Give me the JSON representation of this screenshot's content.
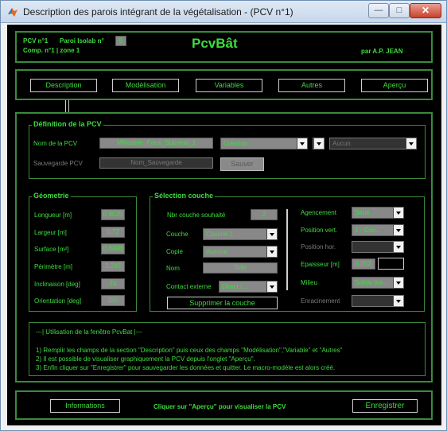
{
  "window": {
    "title": "Description des parois intégrant de la végétalisation - (PCV n°1)",
    "min_glyph": "—",
    "max_glyph": "□",
    "close_glyph": "✕"
  },
  "header": {
    "pcv_label": "PCV n°1",
    "paroi_label": "Paroi Isolab n°",
    "paroi_value": "5",
    "comp_label": "Comp. n°1 | zone 1",
    "app_name": "PcvBât",
    "author": "par A.P. JEAN"
  },
  "tabs": {
    "description": "Description",
    "modelisation": "Modélisation",
    "variables": "Variables",
    "autres": "Autres",
    "apercu": "Aperçu"
  },
  "definition": {
    "title": "Définition de la PCV",
    "nom_label": "Nom de la  PCV",
    "nom_value": "MModele_Paroi_Substrat_1",
    "mode_value": "Création",
    "aucun_value": "Aucun",
    "sauvegarde_label": "Sauvegarde PCV",
    "sauvegarde_value": "Nom_Sauvegarde",
    "sauver_label": "Sauver"
  },
  "geometrie": {
    "title": "Géometrie",
    "rows": [
      {
        "label": "Longueur [m]",
        "value": "0.9025"
      },
      {
        "label": "Largeur [m]",
        "value": "0.72"
      },
      {
        "label": "Surface [m²]",
        "value": "0.6498"
      },
      {
        "label": "Périmètre  [m]",
        "value": "3.245"
      },
      {
        "label": "Inclinaison [deg]",
        "value": "24"
      },
      {
        "label": "Orientation [deg]",
        "value": "180"
      }
    ]
  },
  "selection": {
    "title": "Sélection couche",
    "nb_label": "Nbr couche souhaité",
    "nb_value": "2",
    "couche_label": "Couche",
    "couche_value": "Couche 1",
    "copie_label": "Copie",
    "copie_value": "Aucune",
    "nom_label": "Nom",
    "nom_value": "Toile",
    "contact_label": "Contact externe",
    "contact_value": "Direct     (...",
    "supprimer_label": "Supprimer la couche",
    "agencement_label": "Agencement",
    "agencement_value": "Série",
    "posvert_label": "Position vert.",
    "posvert_value": "1  -  Cou...",
    "poshor_label": "Position hor.",
    "poshor_value": "",
    "epaisseur_label": "Epaisseur [m]",
    "epaisseur_value": "0.002",
    "epaisseur_extra": "",
    "milieu_label": "Milieu",
    "milieu_value": "Solide ine...",
    "enracinement_label": "Enracinement",
    "enracinement_value": ""
  },
  "info": {
    "header": "---| Utilisation de la fenêtre PcvBat |---",
    "line1": "1) Remplir les champs de la section \"Description\" puis ceux des champs \"Modélisation\",\"Variable\" et \"Autres\"",
    "line2": "2) Il est possible de visualiser graphiquement la PCV depuis l'onglet \"Aperçu\".",
    "line3": "3) Enfin cliquer sur \"Enregistrer\" pour sauvegarder les données et quitter. Le macro-modèle est alors créé."
  },
  "footer": {
    "informations": "Informations",
    "hint": "Cliquer sur \"Aperçu\" pour visualiser la PCV",
    "enregistrer": "Enregistrer"
  },
  "colors": {
    "accent_green": "#3fdc3f",
    "panel_border": "#3a8a3a",
    "background": "#000000"
  },
  "icons": {
    "app": "matlab-icon"
  }
}
